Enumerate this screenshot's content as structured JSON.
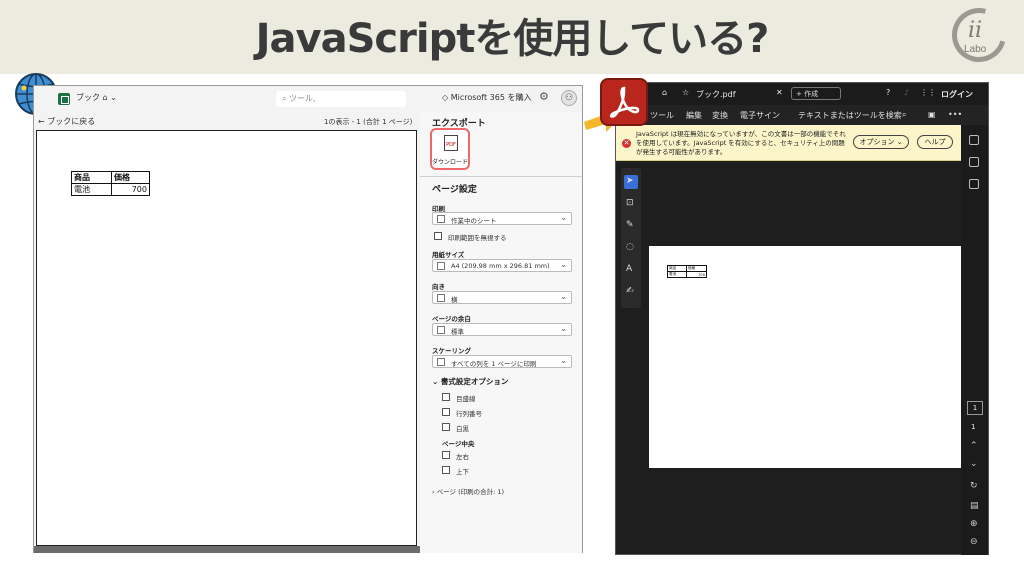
{
  "banner": {
    "title": "JavaScriptを使用している?",
    "logo_text": "Labo",
    "logo_mark": "ii"
  },
  "excel": {
    "book_name": "ブック",
    "search_placeholder": "ツール,",
    "m365_label": "Microsoft 365 を購入",
    "back_label": "ブックに戻る",
    "page_info": "1の表示 - 1 (合計 1 ページ)",
    "sheet": {
      "headers": [
        "商品",
        "価格"
      ],
      "rows": [
        [
          "電池",
          "700"
        ]
      ]
    },
    "panel": {
      "export_title": "エクスポート",
      "pdf_icon_text": "PDF",
      "download_label": "ダウンロード",
      "page_settings_title": "ページ設定",
      "print_label": "印刷",
      "print_value": "作業中のシート",
      "ignore_print_area": "印刷範囲を無視する",
      "paper_size_label": "用紙サイズ",
      "paper_size_value": "A4 (209.98 mm x 296.81 mm)",
      "orientation_label": "向き",
      "orientation_value": "横",
      "margins_label": "ページの余白",
      "margins_value": "標準",
      "scaling_label": "スケーリング",
      "scaling_value": "すべての列を 1 ページに印刷",
      "format_options_title": "書式設定オプション",
      "gridlines": "目盛線",
      "row_col_numbers": "行列番号",
      "black_white": "白黒",
      "page_center_title": "ページ中央",
      "horizontal": "左右",
      "vertical": "上下",
      "pages_collapsed": "ページ (印刷の合計: 1)"
    }
  },
  "acrobat": {
    "tab_name": "ブック.pdf",
    "new_tab_label": "作成",
    "login_label": "ログイン",
    "menu": [
      "ツール",
      "編集",
      "変換",
      "電子サイン"
    ],
    "search_tools_label": "テキストまたはツールを検索",
    "warning_text": "JavaScript は現在無効になっていますが、この文書は一部の機能でそれを使用しています。JavaScript を有効にすると、セキュリティ上の問題が発生する可能性があります。",
    "options_button": "オプション",
    "help_button": "ヘルプ",
    "page_number": "1",
    "page_total": "1",
    "table": {
      "headers": [
        "商品",
        "価格"
      ],
      "rows": [
        [
          "電池",
          "700"
        ]
      ]
    }
  },
  "colors": {
    "banner_bg": "#ecebdf",
    "excel_green": "#1e7145",
    "acrobat_red": "#b8261c",
    "warning_bg": "#fbf5c9",
    "highlight": "#ee6a6a",
    "arrow": "#f5b62a"
  }
}
